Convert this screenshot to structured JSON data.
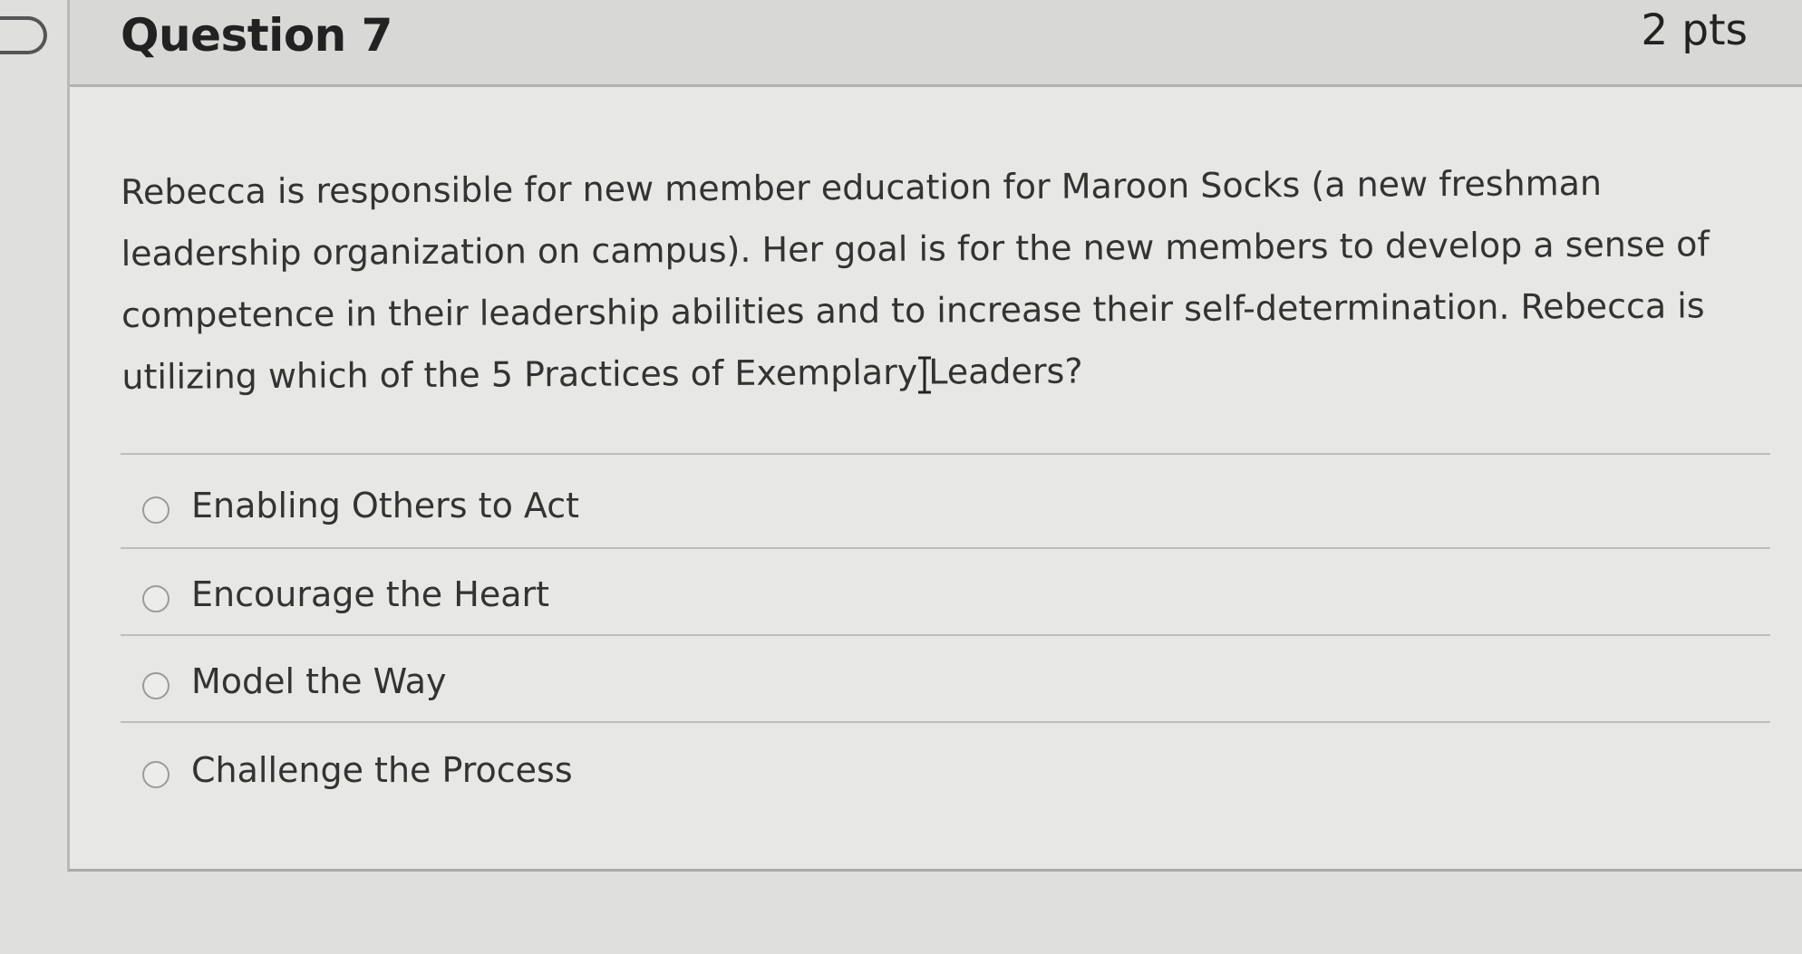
{
  "question": {
    "title": "Question 7",
    "points": "2 pts",
    "text": "Rebecca is responsible for new member education for Maroon Socks (a new freshman leadership organization on campus). Her goal is for the new members to develop a sense of competence in their leadership abilities and to increase their self-determination. Rebecca is utilizing which of the 5 Practices of Exemplary Leaders?"
  },
  "answers": [
    {
      "label": "Enabling Others to Act",
      "selected": false
    },
    {
      "label": "Encourage the Heart",
      "selected": false
    },
    {
      "label": "Model the Way",
      "selected": false
    },
    {
      "label": "Challenge the Process",
      "selected": false
    }
  ],
  "icons": {
    "flag": "flag-icon",
    "cursor": "text-cursor-icon"
  },
  "colors": {
    "background": "#dfdfdd",
    "header": "#d8d8d6",
    "text": "#333333"
  }
}
